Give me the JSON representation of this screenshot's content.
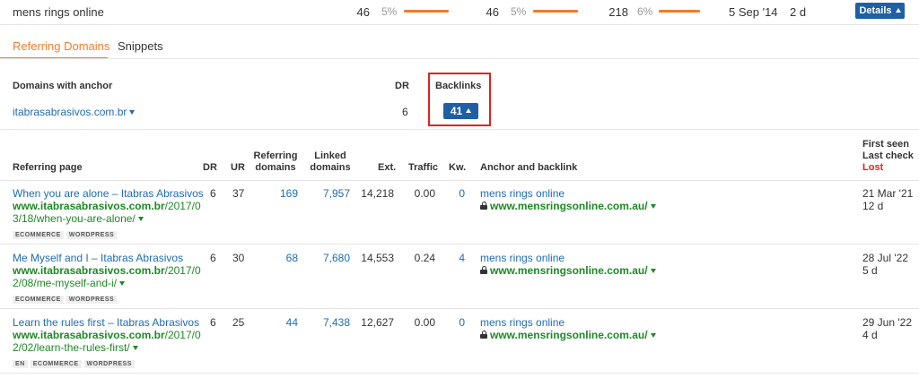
{
  "top_row": {
    "keyword": "mens rings online",
    "col1_value": "46",
    "col1_pct": "5%",
    "col2_value": "46",
    "col2_pct": "5%",
    "col3_value": "218",
    "col3_pct": "6%",
    "date": "5 Sep '14",
    "age": "2 d",
    "details_label": "Details"
  },
  "tabs": [
    {
      "label": "Referring Domains",
      "active": true
    },
    {
      "label": "Snippets",
      "active": false
    }
  ],
  "domains_table": {
    "headers": {
      "domain": "Domains with anchor",
      "dr": "DR",
      "backlinks": "Backlinks"
    },
    "row": {
      "domain": "itabrasabrasivos.com.br",
      "dr": "6",
      "backlinks": "41"
    }
  },
  "refpages_table": {
    "headers": {
      "referring_page": "Referring page",
      "dr": "DR",
      "ur": "UR",
      "referring_domains_1": "Referring",
      "referring_domains_2": "domains",
      "linked_domains_1": "Linked",
      "linked_domains_2": "domains",
      "ext": "Ext.",
      "traffic": "Traffic",
      "kw": "Kw.",
      "anchor": "Anchor and backlink",
      "first_seen": "First seen",
      "last_check": "Last check",
      "lost": "Lost"
    },
    "rows": [
      {
        "title": "When you are alone – Itabras Abrasivos",
        "url_domain": "www.itabrasabrasivos.com.br",
        "url_path_1": "/2017/0",
        "url_path_2": "3/18/when-you-are-alone/",
        "tags": [
          "ECOMMERCE",
          "WORDPRESS"
        ],
        "dr": "6",
        "ur": "37",
        "ref_domains": "169",
        "linked_domains": "7,957",
        "ext": "14,218",
        "traffic": "0.00",
        "kw": "0",
        "anchor": "mens rings online",
        "backlink": "www.mensringsonline.com.au/",
        "first_seen": "21 Mar '21",
        "last_check": "12 d"
      },
      {
        "title": "Me Myself and I – Itabras Abrasivos",
        "url_domain": "www.itabrasabrasivos.com.br",
        "url_path_1": "/2017/0",
        "url_path_2": "2/08/me-myself-and-i/",
        "tags": [
          "ECOMMERCE",
          "WORDPRESS"
        ],
        "dr": "6",
        "ur": "30",
        "ref_domains": "68",
        "linked_domains": "7,680",
        "ext": "14,553",
        "traffic": "0.24",
        "kw": "4",
        "anchor": "mens rings online",
        "backlink": "www.mensringsonline.com.au/",
        "first_seen": "28 Jul '22",
        "last_check": "5 d"
      },
      {
        "title": "Learn the rules first – Itabras Abrasivos",
        "url_domain": "www.itabrasabrasivos.com.br",
        "url_path_1": "/2017/0",
        "url_path_2": "2/02/learn-the-rules-first/",
        "tags": [
          "EN",
          "ECOMMERCE",
          "WORDPRESS"
        ],
        "dr": "6",
        "ur": "25",
        "ref_domains": "44",
        "linked_domains": "7,438",
        "ext": "12,627",
        "traffic": "0.00",
        "kw": "0",
        "anchor": "mens rings online",
        "backlink": "www.mensringsonline.com.au/",
        "first_seen": "29 Jun '22",
        "last_check": "4 d"
      }
    ]
  },
  "colors": {
    "accent_orange": "#f07c2c",
    "link_blue": "#1f6cb0",
    "url_green": "#1d8a25",
    "button_blue": "#1f5fa6",
    "highlight_red": "#d9261c"
  }
}
